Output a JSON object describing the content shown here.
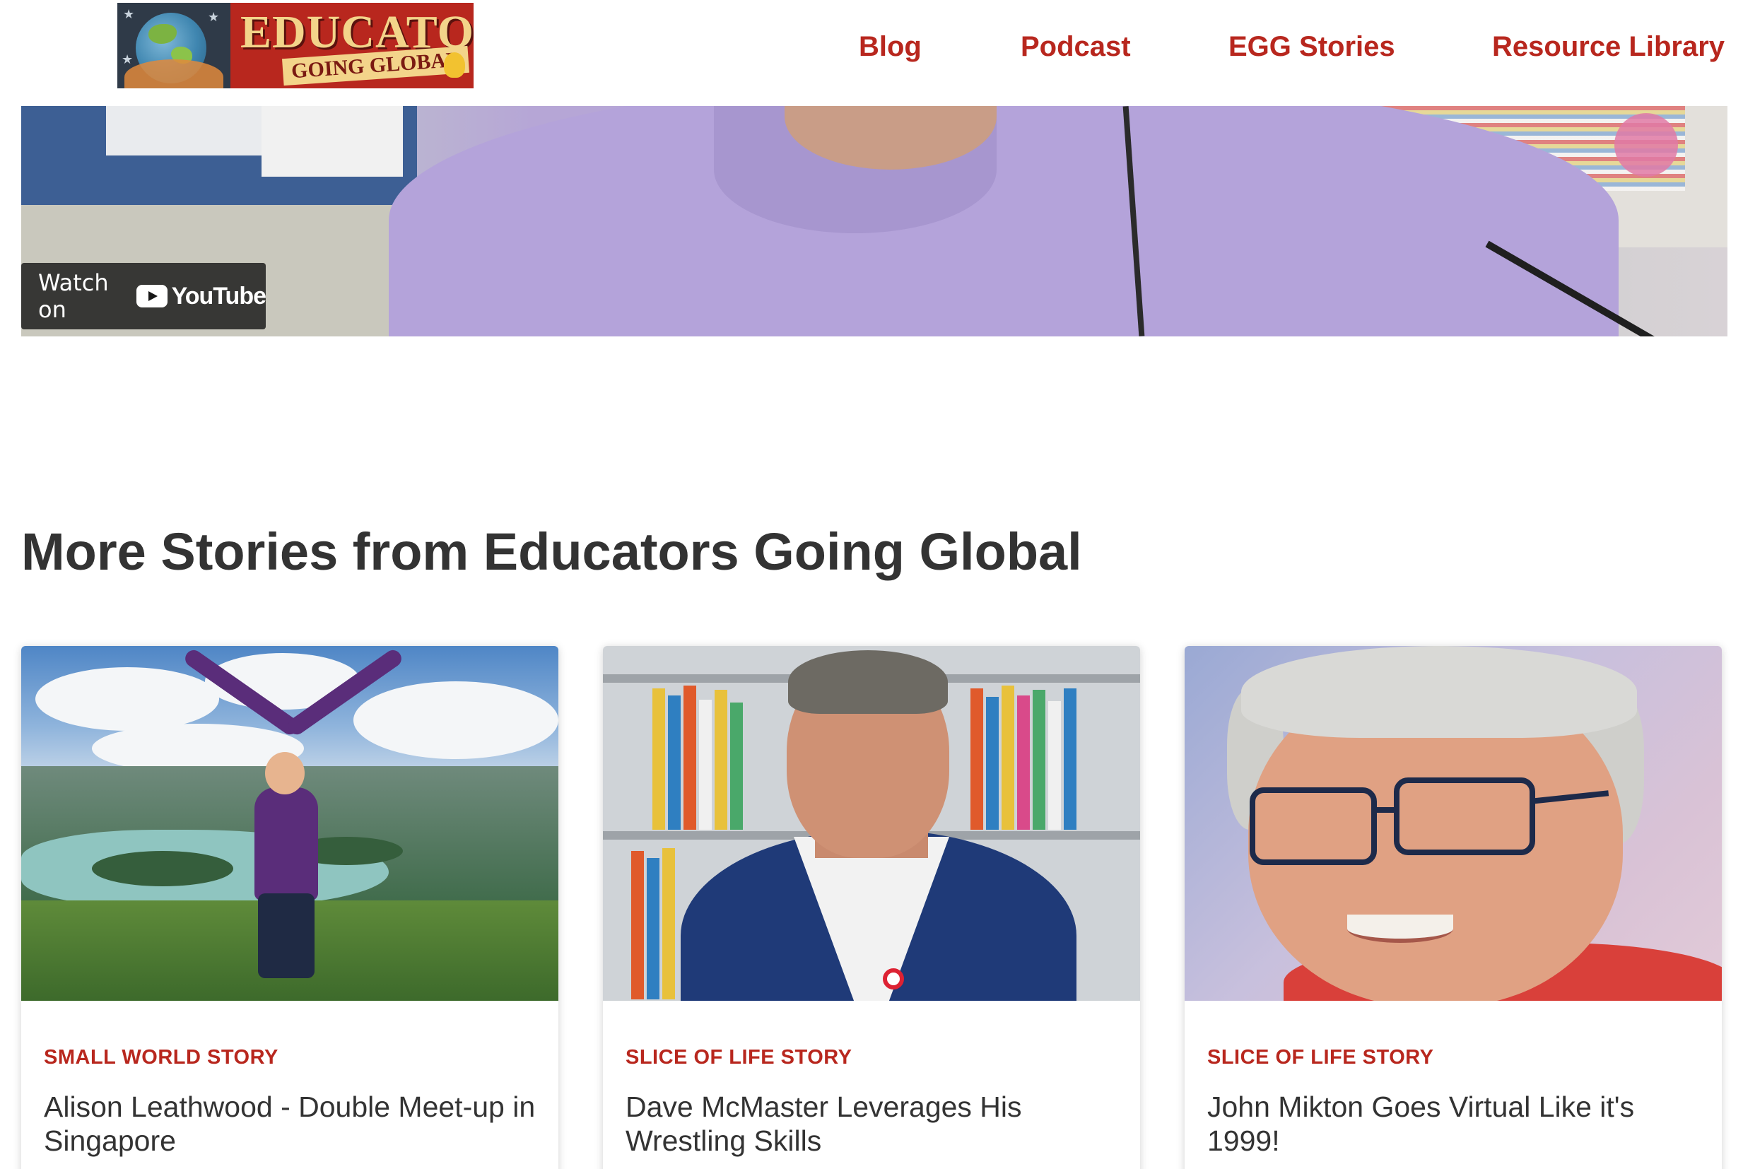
{
  "header": {
    "logo": {
      "title": "EDUCATORS",
      "subtitle": "GOING GLOBAL"
    },
    "nav": [
      {
        "label": "Blog"
      },
      {
        "label": "Podcast"
      },
      {
        "label": "EGG Stories"
      },
      {
        "label": "Resource Library"
      }
    ],
    "accent_color": "#b8271e"
  },
  "video": {
    "watch_on_label": "Watch on",
    "youtube_label": "YouTube"
  },
  "section": {
    "title": "More Stories from Educators Going Global"
  },
  "cards": [
    {
      "category": "SMALL WORLD STORY",
      "title": "Alison Leathwood - Double Meet-up in Singapore"
    },
    {
      "category": "SLICE OF LIFE STORY",
      "title": "Dave McMaster Leverages His Wrestling Skills"
    },
    {
      "category": "SLICE OF LIFE STORY",
      "title": "John Mikton Goes Virtual Like it's 1999!"
    }
  ]
}
